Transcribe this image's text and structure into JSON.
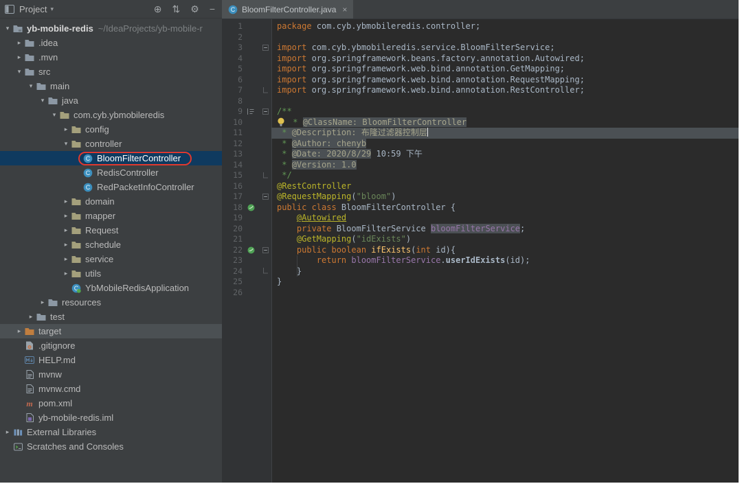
{
  "colors": {
    "editor_background": "#2B2B2B",
    "panel_background": "#3C3F41",
    "annotation_box_red": "#E0392E",
    "selected_row_blue": "#0F3A5F",
    "target_row_gray": "#4B5053",
    "keyword_orange": "#CC7832",
    "string_green": "#6A8759",
    "annotation_yellow": "#BBB529"
  },
  "project_panel": {
    "header": {
      "icon": "project-tool-window-icon",
      "title": "Project",
      "caret": "▾",
      "toolbar": [
        {
          "name": "locate-file-icon",
          "glyph": "⊕"
        },
        {
          "name": "collapse-all-icon",
          "glyph": "⇅"
        },
        {
          "name": "options-gear-icon",
          "glyph": "⚙"
        },
        {
          "name": "hide-panel-icon",
          "glyph": "−"
        }
      ]
    },
    "tree": [
      {
        "label": "yb-mobile-redis",
        "detail": "~/IdeaProjects/yb-mobile-r",
        "depth": 0,
        "arrow": "expanded",
        "icon": "project-folder-icon",
        "bold": true
      },
      {
        "label": ".idea",
        "depth": 1,
        "arrow": "collapsed",
        "icon": "folder-icon"
      },
      {
        "label": ".mvn",
        "depth": 1,
        "arrow": "collapsed",
        "icon": "folder-icon"
      },
      {
        "label": "src",
        "depth": 1,
        "arrow": "expanded",
        "icon": "folder-icon"
      },
      {
        "label": "main",
        "depth": 2,
        "arrow": "expanded",
        "icon": "folder-icon"
      },
      {
        "label": "java",
        "depth": 3,
        "arrow": "expanded",
        "icon": "folder-icon"
      },
      {
        "label": "com.cyb.ybmobileredis",
        "depth": 4,
        "arrow": "expanded",
        "icon": "package-icon"
      },
      {
        "label": "config",
        "depth": 5,
        "arrow": "collapsed",
        "icon": "package-icon"
      },
      {
        "label": "controller",
        "depth": 5,
        "arrow": "expanded",
        "icon": "package-icon"
      },
      {
        "label": "BloomFilterController",
        "depth": 6,
        "icon": "java-class-icon",
        "selected": true,
        "annotated": true
      },
      {
        "label": "RedisController",
        "depth": 6,
        "icon": "java-class-icon"
      },
      {
        "label": "RedPacketInfoController",
        "depth": 6,
        "icon": "java-class-icon"
      },
      {
        "label": "domain",
        "depth": 5,
        "arrow": "collapsed",
        "icon": "package-icon"
      },
      {
        "label": "mapper",
        "depth": 5,
        "arrow": "collapsed",
        "icon": "package-icon"
      },
      {
        "label": "Request",
        "depth": 5,
        "arrow": "collapsed",
        "icon": "package-icon"
      },
      {
        "label": "schedule",
        "depth": 5,
        "arrow": "collapsed",
        "icon": "package-icon"
      },
      {
        "label": "service",
        "depth": 5,
        "arrow": "collapsed",
        "icon": "package-icon"
      },
      {
        "label": "utils",
        "depth": 5,
        "arrow": "collapsed",
        "icon": "package-icon"
      },
      {
        "label": "YbMobileRedisApplication",
        "depth": 5,
        "icon": "spring-boot-class-icon"
      },
      {
        "label": "resources",
        "depth": 3,
        "arrow": "collapsed",
        "icon": "folder-icon"
      },
      {
        "label": "test",
        "depth": 2,
        "arrow": "collapsed",
        "icon": "folder-icon"
      },
      {
        "label": "target",
        "depth": 1,
        "arrow": "collapsed",
        "icon": "excluded-folder-icon",
        "row_highlight": true
      },
      {
        "label": ".gitignore",
        "depth": 1,
        "icon": "gitignore-file-icon"
      },
      {
        "label": "HELP.md",
        "depth": 1,
        "icon": "markdown-file-icon"
      },
      {
        "label": "mvnw",
        "depth": 1,
        "icon": "file-icon"
      },
      {
        "label": "mvnw.cmd",
        "depth": 1,
        "icon": "file-icon"
      },
      {
        "label": "pom.xml",
        "depth": 1,
        "icon": "maven-file-icon"
      },
      {
        "label": "yb-mobile-redis.iml",
        "depth": 1,
        "icon": "iml-file-icon"
      },
      {
        "label": "External Libraries",
        "depth": 0,
        "arrow": "collapsed",
        "icon": "libraries-icon"
      },
      {
        "label": "Scratches and Consoles",
        "depth": 0,
        "icon": "scratches-icon"
      }
    ]
  },
  "editor": {
    "tab": {
      "icon": "java-class-icon",
      "label": "BloomFilterController.java",
      "close_icon": "×"
    },
    "gutter_icons": {
      "bean": "spring-bean-icon",
      "doc": "doc-preview-icon",
      "bulb": "intention-bulb-icon"
    },
    "code_lines": [
      {
        "n": 1,
        "tokens": [
          {
            "c": "kw",
            "t": "package "
          },
          {
            "c": "pln",
            "t": "com.cyb.ybmobileredis.controller;"
          }
        ]
      },
      {
        "n": 2,
        "tokens": []
      },
      {
        "n": 3,
        "fold": "start",
        "tokens": [
          {
            "c": "kw",
            "t": "import "
          },
          {
            "c": "pln",
            "t": "com.cyb.ybmobileredis.service.BloomFilterService;"
          }
        ]
      },
      {
        "n": 4,
        "tokens": [
          {
            "c": "kw",
            "t": "import "
          },
          {
            "c": "pln",
            "t": "org.springframework.beans.factory.annotation.Autowired;"
          }
        ]
      },
      {
        "n": 5,
        "tokens": [
          {
            "c": "kw",
            "t": "import "
          },
          {
            "c": "pln",
            "t": "org.springframework.web.bind.annotation.GetMapping;"
          }
        ]
      },
      {
        "n": 6,
        "tokens": [
          {
            "c": "kw",
            "t": "import "
          },
          {
            "c": "pln",
            "t": "org.springframework.web.bind.annotation.RequestMapping;"
          }
        ]
      },
      {
        "n": 7,
        "fold": "end",
        "tokens": [
          {
            "c": "kw",
            "t": "import "
          },
          {
            "c": "pln",
            "t": "org.springframework.web.bind.annotation.RestController;"
          }
        ]
      },
      {
        "n": 8,
        "tokens": []
      },
      {
        "n": 9,
        "gutter": "doc",
        "fold": "start",
        "tokens": [
          {
            "c": "cmt",
            "t": "/**"
          }
        ]
      },
      {
        "n": 10,
        "bulb": true,
        "tokens": [
          {
            "c": "cmt",
            "t": " * "
          },
          {
            "c": "doc hl",
            "t": "@ClassName: BloomFilterController"
          }
        ]
      },
      {
        "n": 11,
        "cur": true,
        "caret": true,
        "tokens": [
          {
            "c": "cmt",
            "t": " * "
          },
          {
            "c": "doc hl",
            "t": "@Description: 布隆过滤器控制层"
          }
        ]
      },
      {
        "n": 12,
        "tokens": [
          {
            "c": "cmt",
            "t": " * "
          },
          {
            "c": "doc hl",
            "t": "@Author: chenyb"
          }
        ]
      },
      {
        "n": 13,
        "tokens": [
          {
            "c": "cmt",
            "t": " * "
          },
          {
            "c": "doc hl",
            "t": "@Date: 2020/8/29"
          },
          {
            "c": "pln",
            "t": " 10:59 下午"
          }
        ]
      },
      {
        "n": 14,
        "tokens": [
          {
            "c": "cmt",
            "t": " * "
          },
          {
            "c": "doc hl",
            "t": "@Version: 1.0"
          }
        ]
      },
      {
        "n": 15,
        "fold": "end",
        "tokens": [
          {
            "c": "cmt",
            "t": " */"
          }
        ]
      },
      {
        "n": 16,
        "tokens": [
          {
            "c": "ann",
            "t": "@RestController"
          }
        ]
      },
      {
        "n": 17,
        "fold": "start",
        "tokens": [
          {
            "c": "ann",
            "t": "@RequestMapping"
          },
          {
            "c": "pln",
            "t": "("
          },
          {
            "c": "str",
            "t": "\"bloom\""
          },
          {
            "c": "pln",
            "t": ")"
          }
        ]
      },
      {
        "n": 18,
        "gutter": "bean",
        "tokens": [
          {
            "c": "kw",
            "t": "public class "
          },
          {
            "c": "pln",
            "t": "BloomFilterController {"
          }
        ]
      },
      {
        "n": 19,
        "tokens": [
          {
            "c": "pln",
            "t": "    "
          },
          {
            "c": "annu",
            "t": "@Autowired"
          }
        ]
      },
      {
        "n": 20,
        "tokens": [
          {
            "c": "pln",
            "t": "    "
          },
          {
            "c": "kw",
            "t": "private "
          },
          {
            "c": "pln",
            "t": "BloomFilterService "
          },
          {
            "c": "fld hl",
            "t": "bloomFilterService"
          },
          {
            "c": "pln",
            "t": ";"
          }
        ]
      },
      {
        "n": 21,
        "tokens": [
          {
            "c": "pln",
            "t": "    "
          },
          {
            "c": "ann",
            "t": "@GetMapping"
          },
          {
            "c": "pln",
            "t": "("
          },
          {
            "c": "str",
            "t": "\"idExists\""
          },
          {
            "c": "pln",
            "t": ")"
          }
        ]
      },
      {
        "n": 22,
        "gutter": "bean",
        "fold": "start",
        "tokens": [
          {
            "c": "pln",
            "t": "    "
          },
          {
            "c": "kw",
            "t": "public boolean "
          },
          {
            "c": "mth",
            "t": "ifExists"
          },
          {
            "c": "pln",
            "t": "("
          },
          {
            "c": "kw",
            "t": "int"
          },
          {
            "c": "pln",
            "t": " id){"
          }
        ]
      },
      {
        "n": 23,
        "tokens": [
          {
            "c": "pln",
            "t": "        "
          },
          {
            "c": "kw",
            "t": "return "
          },
          {
            "c": "fld",
            "t": "bloomFilterService"
          },
          {
            "c": "pln",
            "t": "."
          },
          {
            "c": "bold",
            "t": "userIdExists"
          },
          {
            "c": "pln",
            "t": "(id);"
          }
        ]
      },
      {
        "n": 24,
        "fold": "end",
        "tokens": [
          {
            "c": "pln",
            "t": "    }"
          }
        ]
      },
      {
        "n": 25,
        "tokens": [
          {
            "c": "pln",
            "t": "}"
          }
        ]
      },
      {
        "n": 26,
        "tokens": []
      }
    ]
  }
}
